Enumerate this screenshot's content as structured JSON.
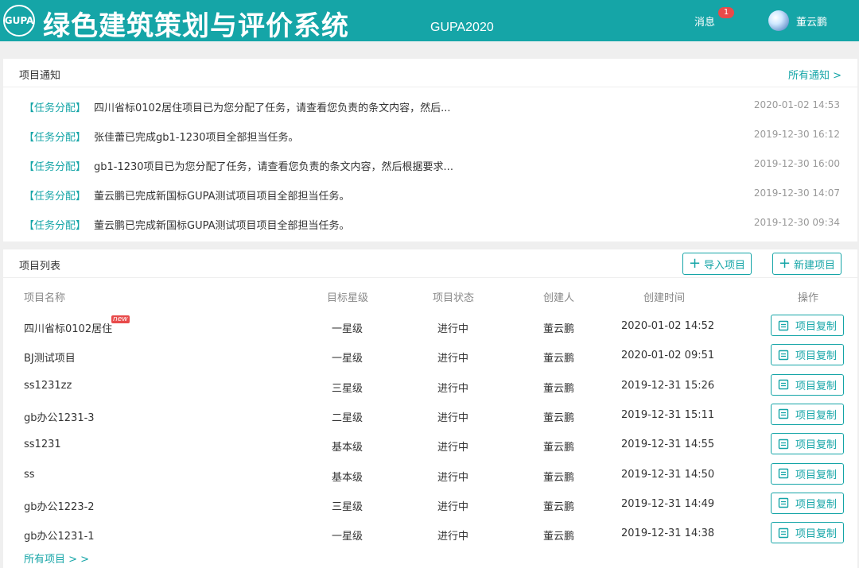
{
  "header": {
    "logo_text": "GUPA",
    "title": "绿色建筑策划与评价系统",
    "subtitle": "GUPA2020",
    "messages_label": "消息",
    "messages_count": "1",
    "username": "董云鹏",
    "accent_color": "#15a5a7"
  },
  "notices": {
    "title": "项目通知",
    "all_link": "所有通知 >",
    "items": [
      {
        "tag": "【任务分配】",
        "text": "四川省标0102居住项目已为您分配了任务，请查看您负责的条文内容，然后...",
        "time": "2020-01-02 14:53"
      },
      {
        "tag": "【任务分配】",
        "text": "张佳蕾已完成gb1-1230项目全部担当任务。",
        "time": "2019-12-30 16:12"
      },
      {
        "tag": "【任务分配】",
        "text": "gb1-1230项目已为您分配了任务，请查看您负责的条文内容，然后根据要求...",
        "time": "2019-12-30 16:00"
      },
      {
        "tag": "【任务分配】",
        "text": "董云鹏已完成新国标GUPA测试项目项目全部担当任务。",
        "time": "2019-12-30 14:07"
      },
      {
        "tag": "【任务分配】",
        "text": "董云鹏已完成新国标GUPA测试项目项目全部担当任务。",
        "time": "2019-12-30 09:34"
      }
    ]
  },
  "projects": {
    "title": "项目列表",
    "import_label": "导入项目",
    "create_label": "新建项目",
    "columns": [
      "项目名称",
      "目标星级",
      "项目状态",
      "创建人",
      "创建时间",
      "操作"
    ],
    "new_badge": "new",
    "copy_label": "项目复制",
    "all_link": "所有项目 > >",
    "rows": [
      {
        "name": "四川省标0102居住",
        "star": "一星级",
        "status": "进行中",
        "creator": "董云鹏",
        "time": "2020-01-02 14:52"
      },
      {
        "name": "BJ测试项目",
        "star": "一星级",
        "status": "进行中",
        "creator": "董云鹏",
        "time": "2020-01-02 09:51"
      },
      {
        "name": "ss1231zz",
        "star": "三星级",
        "status": "进行中",
        "creator": "董云鹏",
        "time": "2019-12-31 15:26"
      },
      {
        "name": "gb办公1231-3",
        "star": "二星级",
        "status": "进行中",
        "creator": "董云鹏",
        "time": "2019-12-31 15:11"
      },
      {
        "name": "ss1231",
        "star": "基本级",
        "status": "进行中",
        "creator": "董云鹏",
        "time": "2019-12-31 14:55"
      },
      {
        "name": "ss",
        "star": "基本级",
        "status": "进行中",
        "creator": "董云鹏",
        "time": "2019-12-31 14:50"
      },
      {
        "name": "gb办公1223-2",
        "star": "三星级",
        "status": "进行中",
        "creator": "董云鹏",
        "time": "2019-12-31 14:49"
      },
      {
        "name": "gb办公1231-1",
        "star": "一星级",
        "status": "进行中",
        "creator": "董云鹏",
        "time": "2019-12-31 14:38"
      }
    ]
  }
}
